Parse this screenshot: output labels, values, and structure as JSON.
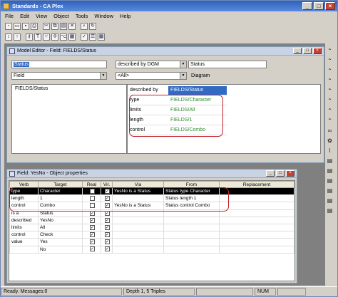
{
  "app": {
    "title": "Standards - CA Plex"
  },
  "menu": [
    "File",
    "Edit",
    "View",
    "Object",
    "Tools",
    "Window",
    "Help"
  ],
  "editor": {
    "title": "Model Editor - Field: FIELDS/Status",
    "object_value": "Status",
    "verb_value": "described by DGM",
    "target_value": "Status",
    "type_value": "Field",
    "filter_value": "<All>",
    "view_value": "Diagram",
    "left_items": [
      "FIELDS/Status"
    ],
    "rows": [
      {
        "verb": "described by",
        "target": "FIELDS/Status",
        "selected": true
      },
      {
        "verb": "type",
        "target": "FIELDS/Character"
      },
      {
        "verb": "limits",
        "target": "FIELDS/All"
      },
      {
        "verb": "length",
        "target": "FIELDS/1"
      },
      {
        "verb": "control",
        "target": "FIELDS/Combo"
      }
    ]
  },
  "props": {
    "title": "Field: YesNo - Object properties",
    "columns": [
      "Verb",
      "Target",
      "Real",
      "Vir.",
      "Via",
      "From",
      "Replacement"
    ],
    "rows": [
      {
        "verb": "type",
        "target": "Character",
        "real": false,
        "vir": true,
        "via": "YesNo is a Status",
        "from": "Status type Character",
        "repl": "",
        "black": true
      },
      {
        "verb": "length",
        "target": "1",
        "real": false,
        "vir": true,
        "via": "",
        "from": "Status length 1",
        "repl": ""
      },
      {
        "verb": "control",
        "target": "Combo",
        "real": false,
        "vir": true,
        "via": "YesNo is a Status",
        "from": "Status control Combo",
        "repl": ""
      },
      {
        "verb": "is a",
        "target": "Status",
        "real": true,
        "vir": true,
        "via": "",
        "from": "",
        "repl": ""
      },
      {
        "verb": "described",
        "target": "YesNo",
        "real": true,
        "vir": true,
        "via": "",
        "from": "",
        "repl": ""
      },
      {
        "verb": "limits",
        "target": "All",
        "real": true,
        "vir": true,
        "via": "",
        "from": "",
        "repl": ""
      },
      {
        "verb": "control",
        "target": "Check",
        "real": true,
        "vir": true,
        "via": "",
        "from": "",
        "repl": ""
      },
      {
        "verb": "value",
        "target": "Yes",
        "real": true,
        "vir": true,
        "via": "",
        "from": "",
        "repl": ""
      },
      {
        "verb": "",
        "target": "No",
        "real": true,
        "vir": true,
        "via": "",
        "from": "",
        "repl": ""
      }
    ]
  },
  "status": {
    "ready": "Ready.  Messages:0",
    "depth": "Depth 1,  5 Triples",
    "num": "NUM"
  },
  "colors": {
    "title_bar": "#2e62b8",
    "highlight_red": "#c0202a",
    "green_text": "#2a8a2a",
    "selection": "#316ac5"
  }
}
